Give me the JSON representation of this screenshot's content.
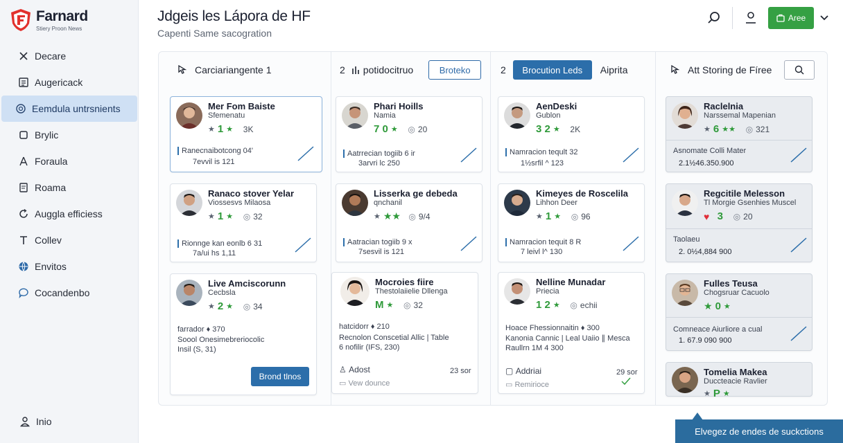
{
  "brand": {
    "name": "Farnard",
    "tagline": "Stiery Proon News"
  },
  "sidebar": {
    "items": [
      {
        "label": "Decare",
        "icon": "cross-icon"
      },
      {
        "label": "Augericack",
        "icon": "list-icon"
      },
      {
        "label": "Eemdula untrsnients",
        "icon": "target-icon",
        "active": true
      },
      {
        "label": "Brylic",
        "icon": "square-icon"
      },
      {
        "label": "Foraula",
        "icon": "person-icon"
      },
      {
        "label": "Roama",
        "icon": "document-icon"
      },
      {
        "label": "Auggla efficiess",
        "icon": "refresh-icon"
      },
      {
        "label": "Collev",
        "icon": "text-icon"
      },
      {
        "label": "Envitos",
        "icon": "globe-icon"
      },
      {
        "label": "Cocandenbo",
        "icon": "chat-icon"
      }
    ],
    "bottom": {
      "label": "Inio",
      "icon": "person-icon"
    }
  },
  "header": {
    "title": "Jdgeis les Lápora de HF",
    "subtitle": "Capenti Same sacogration",
    "button_label": "Aree"
  },
  "columns": [
    {
      "title": "Carciariangente 1",
      "cards": [
        {
          "name": "Mer Fom Baiste",
          "sub": "Sfemenatu",
          "score": "1",
          "count": "3K",
          "note1": "Ranecnaibotcong 04'",
          "note2": "7evvil is 121"
        },
        {
          "name": "Ranaco stover Yelar",
          "sub": "Viossesvs Milaosa",
          "score": "1",
          "count": "32",
          "note1": "Rionnge kan eonlb 6 31",
          "note2": "7a/ui hs 1,11"
        },
        {
          "name": "Live Amciscorunn",
          "sub": "Cecbsla",
          "score": "2",
          "count": "34",
          "note1": "farrador ♦ 370",
          "note2": "Soool Onesimebreriocolic",
          "note3": "Insil (S, 31)",
          "button": "Brond tlnos"
        }
      ]
    },
    {
      "number": "2",
      "title": "potidocitruo",
      "button": "Broteko",
      "cards": [
        {
          "name": "Phari Hoills",
          "sub": "Namia",
          "score": "7 0",
          "count": "20",
          "note1": "Aatrrecian togiib 6 ir",
          "note2": "3arvri lc 250"
        },
        {
          "name": "Lisserka ge debeda",
          "sub": "qnchanil",
          "score": "",
          "count": "9/4",
          "note1": "Aatracian togiib 9 x",
          "note2": "7sesvil is 121"
        },
        {
          "name": "Mocroies fiire",
          "sub": "Thestolaiielie Dllenga",
          "score": "M",
          "count": "32",
          "note1": "hatcidorr ♦ 210",
          "note2": "Recnolon Conscetial Allic | Table",
          "note3": "6 nofilir (IFS, 230)",
          "foot1": "Adost",
          "foot1_val": "23 sor",
          "foot2": "Vew dounce"
        }
      ]
    },
    {
      "number": "2",
      "title": "Aiprita",
      "button": "Brocution Leds",
      "cards": [
        {
          "name": "AenDeski",
          "sub": "Gublon",
          "score": "3 2",
          "count": "2K",
          "note1": "Namracion teqult 32",
          "note2": "1½srfil ^ 123"
        },
        {
          "name": "Kimeyes de Roscelila",
          "sub": "Lihhon Deer",
          "score": "1",
          "count": "96",
          "note1": "Namracion tequit 8 R",
          "note2": "7 leivl l^ 130"
        },
        {
          "name": "Nelline Munadar",
          "sub": "Priecia",
          "score": "1 2",
          "count": "echii",
          "note1": "Hoace Fhessionnaitin ♦ 300",
          "note2": "Kanonia Cannic | Leal Uaiio ∥ Mesca",
          "note3": "Raullrn 1M 4 300",
          "foot1": "Addriai",
          "foot1_val": "29 sor",
          "foot2": "Remirioce"
        }
      ]
    },
    {
      "title": "Att Storing de Fíree",
      "cards": [
        {
          "name": "Raclelnia",
          "sub": "Narssemal Mapenian",
          "score": "6",
          "count": "321",
          "note1": "Asnomate Colli Mater",
          "amount": "2.1½46.350.900"
        },
        {
          "name": "Regcitile Melesson",
          "sub": "Tl Morgie Gsenhies Muscel",
          "score": "3",
          "count": "20",
          "note1": "Taolaeu",
          "amount": "2. 0½4,884 900"
        },
        {
          "name": "Fulles Teusa",
          "sub": "Chogsruar Cacuolo",
          "score": "0",
          "count": "",
          "note1": "Comneace Aiurliore a cual",
          "amount": "1. 67.9 090 900"
        },
        {
          "name": "Tomelia Makea",
          "sub": "Duccteacie Ravlier",
          "score": "P",
          "count": ""
        }
      ]
    }
  ],
  "toast": {
    "label": "Elvegez de endes de suckctions"
  },
  "colors": {
    "accent": "#2c6eaa",
    "success": "#35a043",
    "active_nav": "#cfe0f4"
  }
}
